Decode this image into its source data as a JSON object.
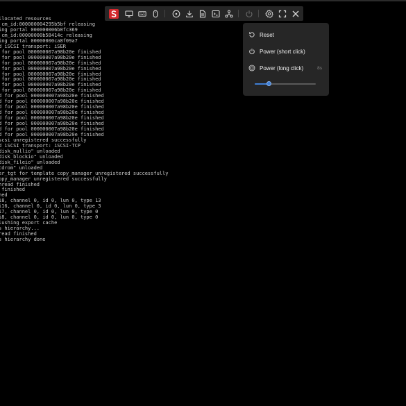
{
  "console": {
    "lines": [
      "llocated resources",
      " cm_id:000000004295b5bf releasing",
      "ing portal 000000006b0fc369",
      " cm_id:00000000b58414c releasing",
      "ing portal 00000000ca8f09a7",
      "d iSCSI transport: iSER",
      " for pool 000000007a98b20e finished",
      " for pool 000000007a98b20e finished",
      " for pool 000000007a98b20e finished",
      " for pool 000000007a98b20e finished",
      " for pool 000000007a98b20e finished",
      " for pool 000000007a98b20e finished",
      " for pool 000000007a98b20e finished",
      " for pool 000000007a98b20e finished",
      "d for pool 000000007a98b20e finished",
      "d for pool 000000007a98b20e finished",
      "d for pool 000000007a98b20e finished",
      "d for pool 000000007a98b20e finished",
      "d for pool 000000007a98b20e finished",
      "d for pool 000000007a98b20e finished",
      "d for pool 000000007a98b20e finished",
      "d for pool 000000007a98b20e finished",
      "scsi unregistered successfully",
      "d iSCSI transport: iSCSI-TCP",
      "disk_nullio\" unloaded",
      "disk_blockio\" unloaded",
      "disk_fileio\" unloaded",
      "cdrom\" unloaded",
      "er_tgt for template copy_manager unregistered successfully",
      "opy_manager unregistered successfully",
      "hread finished",
      " finished",
      "hed",
      "i8, channel 0, id 0, lun 0, type 13",
      "i16, channel 0, id 0, lun 0, type 3",
      "i7, channel 0, id 0, lun 0, type 0",
      "i8, channel 0, id 0, lun 0, type 0",
      "lushing export cache",
      "s hierarchy...",
      "read finished",
      "s hierarchy done"
    ]
  },
  "toolbar": {
    "logo_letter": "S",
    "buttons": [
      {
        "name": "logo-button",
        "icon": "logo-icon"
      },
      {
        "name": "display-button",
        "icon": "monitor-icon"
      },
      {
        "name": "keyboard-button",
        "icon": "keyboard-icon"
      },
      {
        "name": "mouse-button",
        "icon": "mouse-icon"
      },
      {
        "name": "media-button",
        "icon": "disc-icon"
      },
      {
        "name": "download-button",
        "icon": "download-icon"
      },
      {
        "name": "file-button",
        "icon": "file-icon"
      },
      {
        "name": "terminal-button",
        "icon": "terminal-icon"
      },
      {
        "name": "network-button",
        "icon": "network-icon"
      },
      {
        "name": "power-button",
        "icon": "power-icon"
      },
      {
        "name": "settings-button",
        "icon": "gear-icon"
      },
      {
        "name": "fullscreen-button",
        "icon": "fullscreen-icon"
      },
      {
        "name": "close-button",
        "icon": "close-icon"
      }
    ]
  },
  "power_menu": {
    "reset_label": "Reset",
    "short_click_label": "Power (short click)",
    "long_click_label": "Power (long click)",
    "long_click_duration": "8s",
    "slider_fraction": 0.23
  },
  "colors": {
    "background": "#000000",
    "console_text": "#c9c9c9",
    "toolbar_bg": "#262626",
    "logo_red": "#d4282d",
    "slider_accent": "#3e7fd6"
  }
}
